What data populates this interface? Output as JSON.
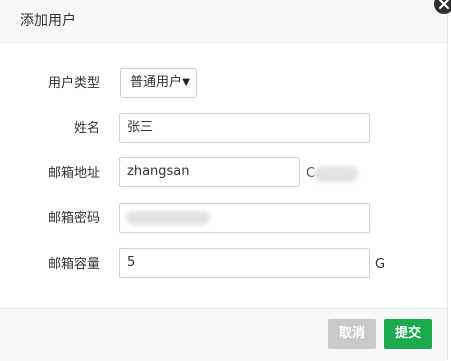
{
  "dialog": {
    "title": "添加用户",
    "fields": {
      "user_type": {
        "label": "用户类型",
        "value": "普通用户"
      },
      "name": {
        "label": "姓名",
        "value": "张三"
      },
      "email": {
        "label": "邮箱地址",
        "value": "zhangsan",
        "suffix": "C"
      },
      "password": {
        "label": "邮箱密码"
      },
      "quota": {
        "label": "邮箱容量",
        "value": "5",
        "unit": "G"
      }
    },
    "buttons": {
      "cancel": "取消",
      "submit": "提交"
    }
  },
  "colors": {
    "primary": "#1aa94c",
    "disabled": "#c9c9c9"
  },
  "icons": {
    "close": "close-icon",
    "dropdown": "caret-down-icon"
  }
}
